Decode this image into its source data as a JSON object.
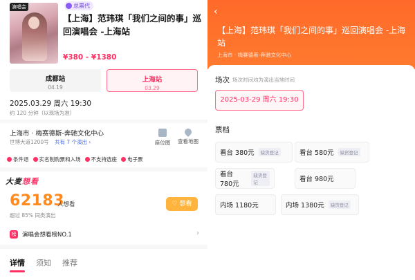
{
  "left": {
    "poster_tag": "演唱会",
    "agent_badge": "总票代",
    "title": "【上海】范玮琪「我们之间的事」巡回演唱会 -上海站",
    "price": "¥380 - ¥1380",
    "cities": [
      {
        "name": "成都站",
        "date": "04.19"
      },
      {
        "name": "上海站",
        "date": "03.29"
      }
    ],
    "datetime": "2025.03.29 周六 19:30",
    "duration": "约 120 分钟（以现场为准）",
    "venue": "上海市 · 梅赛德斯-奔驰文化中心",
    "address": "世博大道1200号",
    "shows": "共有 7 个演出 ›",
    "seat_map_label": "座位图",
    "map_label": "查看地图",
    "policies": [
      "条件退",
      "实名制购票和入场",
      "不支持选座",
      "电子票"
    ],
    "brand_a": "大麦",
    "brand_b": "想看",
    "want_count": "62183",
    "want_unit": "人想看",
    "beat_text": "超过 85% 同类演出",
    "want_button": "♡ 想看",
    "rank_icon": "榜",
    "rank_text": "演唱会想看榜NO.1",
    "rank_arrow": "›",
    "tabs": [
      "详情",
      "须知",
      "推荐"
    ]
  },
  "right": {
    "back": "‹",
    "title": "【上海】范玮琪「我们之间的事」巡回演唱会 -上海站",
    "location": "上海市 · 梅赛德斯-奔驰文化中心",
    "session_heading": "场次",
    "session_note": "场次时间均为演出当地时间",
    "session_selected": "2025-03-29 周六 19:30",
    "ticket_heading": "票档",
    "tickets": [
      {
        "label": "看台 380元",
        "status": "缺货登记"
      },
      {
        "label": "看台 580元",
        "status": "缺货登记"
      },
      {
        "label": "看台 780元",
        "status": "缺货登记"
      },
      {
        "label": "看台 980元",
        "status": ""
      },
      {
        "label": "内场 1180元",
        "status": ""
      },
      {
        "label": "内场 1380元",
        "status": "缺货登记"
      }
    ]
  },
  "colors": {
    "accent": "#ff2e63",
    "header_orange": "#ff6a2a",
    "want_orange": "#ff8a1f"
  }
}
